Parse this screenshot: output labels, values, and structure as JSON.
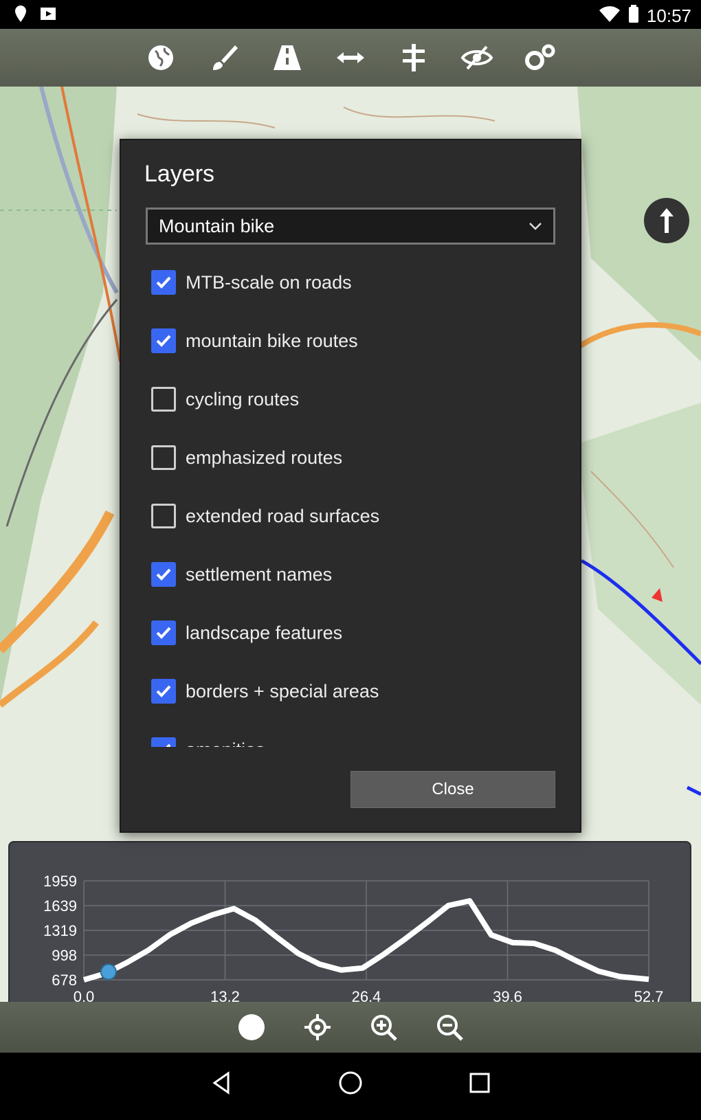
{
  "status_bar": {
    "left_icons": [
      "location-icon",
      "cast-icon"
    ],
    "right_icons": [
      "wifi-icon",
      "battery-icon"
    ],
    "time": "10:57"
  },
  "toolbar": {
    "icons": [
      "globe-icon",
      "brush-icon",
      "road-icon",
      "measure-icon",
      "route-icon",
      "eye-off-icon",
      "settings-icon"
    ]
  },
  "compass": {
    "icon": "compass-arrow-icon"
  },
  "dialog": {
    "title": "Layers",
    "dropdown_value": "Mountain bike",
    "items": [
      {
        "label": "MTB-scale on roads",
        "checked": true
      },
      {
        "label": "mountain bike routes",
        "checked": true
      },
      {
        "label": "cycling routes",
        "checked": false
      },
      {
        "label": "emphasized routes",
        "checked": false
      },
      {
        "label": "extended road surfaces",
        "checked": false
      },
      {
        "label": "settlement names",
        "checked": true
      },
      {
        "label": "landscape features",
        "checked": true
      },
      {
        "label": "borders + special areas",
        "checked": true
      },
      {
        "label": "amenities",
        "checked": true
      }
    ],
    "close_label": "Close"
  },
  "chart_data": {
    "type": "area",
    "x_ticks": [
      "0.0",
      "13.2",
      "26.4",
      "39.6",
      "52.7"
    ],
    "y_ticks": [
      "1959",
      "1639",
      "1319",
      "998",
      "678"
    ],
    "xlim": [
      0,
      52.7
    ],
    "ylim": [
      678,
      1959
    ],
    "x": [
      0.0,
      2.0,
      4.0,
      6.0,
      8.0,
      10.0,
      12.0,
      14.0,
      16.0,
      18.0,
      20.0,
      22.0,
      24.0,
      26.0,
      28.0,
      30.0,
      32.0,
      34.0,
      36.0,
      38.0,
      40.0,
      42.0,
      44.0,
      46.0,
      48.0,
      50.0,
      52.7
    ],
    "y": [
      678,
      760,
      900,
      1060,
      1260,
      1410,
      1520,
      1600,
      1450,
      1230,
      1020,
      880,
      805,
      830,
      1010,
      1210,
      1420,
      1640,
      1700,
      1260,
      1160,
      1150,
      1060,
      920,
      790,
      720,
      685
    ],
    "marker_x": 2.3,
    "marker_color": "#4a9fd8",
    "line_color": "#ffffff"
  },
  "bottom_bar": {
    "icons": [
      "record-icon",
      "locate-icon",
      "zoom-in-icon",
      "zoom-out-icon"
    ]
  },
  "nav_bar": {
    "icons": [
      "back-icon",
      "home-icon",
      "recents-icon"
    ]
  }
}
